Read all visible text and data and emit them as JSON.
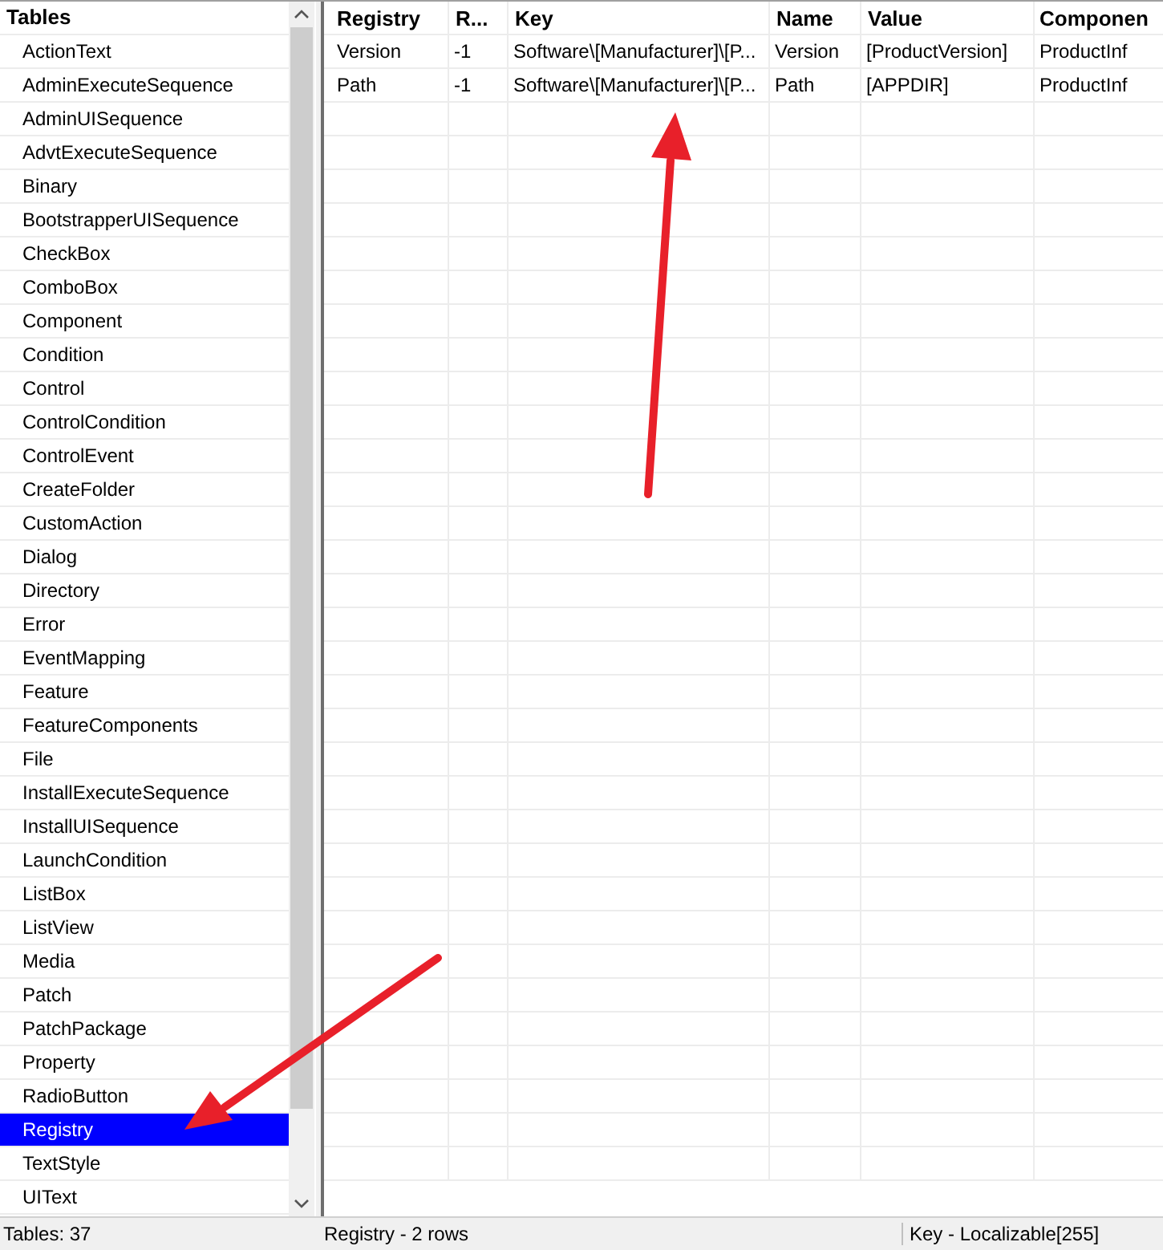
{
  "tables_panel": {
    "title": "Tables",
    "items": [
      {
        "label": "ActionText",
        "selected": false
      },
      {
        "label": "AdminExecuteSequence",
        "selected": false
      },
      {
        "label": "AdminUISequence",
        "selected": false
      },
      {
        "label": "AdvtExecuteSequence",
        "selected": false
      },
      {
        "label": "Binary",
        "selected": false
      },
      {
        "label": "BootstrapperUISequence",
        "selected": false
      },
      {
        "label": "CheckBox",
        "selected": false
      },
      {
        "label": "ComboBox",
        "selected": false
      },
      {
        "label": "Component",
        "selected": false
      },
      {
        "label": "Condition",
        "selected": false
      },
      {
        "label": "Control",
        "selected": false
      },
      {
        "label": "ControlCondition",
        "selected": false
      },
      {
        "label": "ControlEvent",
        "selected": false
      },
      {
        "label": "CreateFolder",
        "selected": false
      },
      {
        "label": "CustomAction",
        "selected": false
      },
      {
        "label": "Dialog",
        "selected": false
      },
      {
        "label": "Directory",
        "selected": false
      },
      {
        "label": "Error",
        "selected": false
      },
      {
        "label": "EventMapping",
        "selected": false
      },
      {
        "label": "Feature",
        "selected": false
      },
      {
        "label": "FeatureComponents",
        "selected": false
      },
      {
        "label": "File",
        "selected": false
      },
      {
        "label": "InstallExecuteSequence",
        "selected": false
      },
      {
        "label": "InstallUISequence",
        "selected": false
      },
      {
        "label": "LaunchCondition",
        "selected": false
      },
      {
        "label": "ListBox",
        "selected": false
      },
      {
        "label": "ListView",
        "selected": false
      },
      {
        "label": "Media",
        "selected": false
      },
      {
        "label": "Patch",
        "selected": false
      },
      {
        "label": "PatchPackage",
        "selected": false
      },
      {
        "label": "Property",
        "selected": false
      },
      {
        "label": "RadioButton",
        "selected": false
      },
      {
        "label": "Registry",
        "selected": true
      },
      {
        "label": "TextStyle",
        "selected": false
      },
      {
        "label": "UIText",
        "selected": false
      }
    ]
  },
  "table": {
    "columns": [
      "Registry",
      "R...",
      "Key",
      "Name",
      "Value",
      "Componen"
    ],
    "rows": [
      [
        "Version",
        "-1",
        "Software\\[Manufacturer]\\[P...",
        "Version",
        "[ProductVersion]",
        "ProductInf"
      ],
      [
        "Path",
        "-1",
        "Software\\[Manufacturer]\\[P...",
        "Path",
        "[APPDIR]",
        "ProductInf"
      ]
    ]
  },
  "status_bar": [
    "Tables: 37",
    "Registry - 2 rows",
    "Key - Localizable[255]"
  ]
}
